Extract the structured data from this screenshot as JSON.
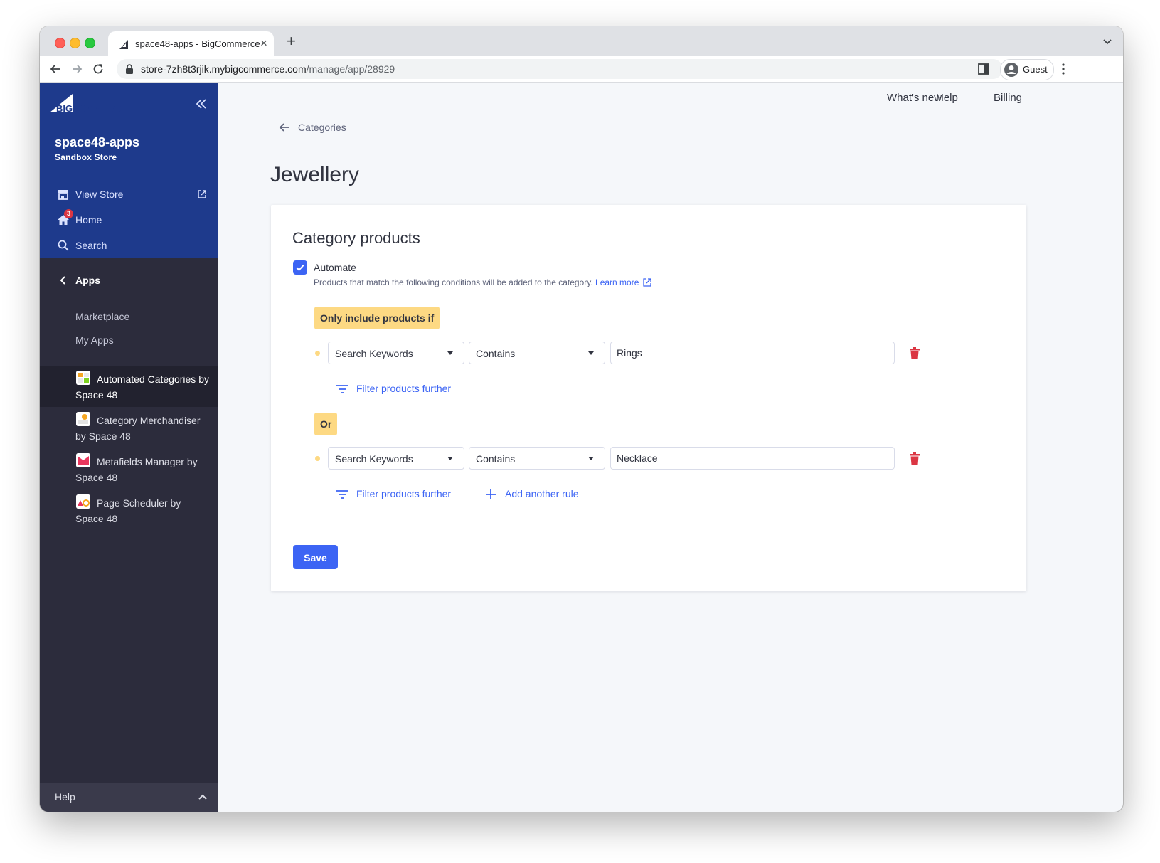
{
  "browser": {
    "tab_title": "space48-apps - BigCommerce",
    "tab_close": "×",
    "new_tab": "+",
    "url_host": "store-7zh8t3rjik.mybigcommerce.com",
    "url_path": "/manage/app/28929",
    "profile_label": "Guest"
  },
  "sidebar": {
    "logo_text": "BIGCOMMERCE",
    "store_name": "space48-apps",
    "store_type": "Sandbox Store",
    "links": [
      {
        "label": "View Store",
        "icon": "storefront-icon"
      },
      {
        "label": "Home",
        "icon": "home-icon",
        "badge": "3"
      },
      {
        "label": "Search",
        "icon": "search-icon"
      }
    ],
    "apps_label": "Apps",
    "sub_links": [
      "Marketplace",
      "My Apps"
    ],
    "apps": [
      {
        "label": "Automated Categories by Space 48",
        "active": true
      },
      {
        "label": "Category Merchandiser by Space 48",
        "active": false
      },
      {
        "label": "Metafields Manager by Space 48",
        "active": false
      },
      {
        "label": "Page Scheduler by Space 48",
        "active": false
      }
    ],
    "help_label": "Help"
  },
  "topnav": {
    "whats_new": "What's new",
    "help": "Help",
    "billing": "Billing"
  },
  "page": {
    "back_label": "Categories",
    "title": "Jewellery"
  },
  "card": {
    "title": "Category products",
    "automate_label": "Automate",
    "automate_checked": true,
    "description": "Products that match the following conditions will be added to the category.",
    "learn_more": "Learn more",
    "first_condition_label": "Only include products if",
    "or_label": "Or",
    "rules": [
      {
        "field": "Search Keywords",
        "operator": "Contains",
        "value": "Rings"
      },
      {
        "field": "Search Keywords",
        "operator": "Contains",
        "value": "Necklace"
      }
    ],
    "filter_further": "Filter products further",
    "add_rule": "Add another rule",
    "save": "Save"
  },
  "colors": {
    "primary": "#3c64f4",
    "sidebar_top": "#1e3a8c",
    "sidebar": "#2c2c3c",
    "condition_badge": "#fdd983",
    "danger": "#db3643"
  }
}
